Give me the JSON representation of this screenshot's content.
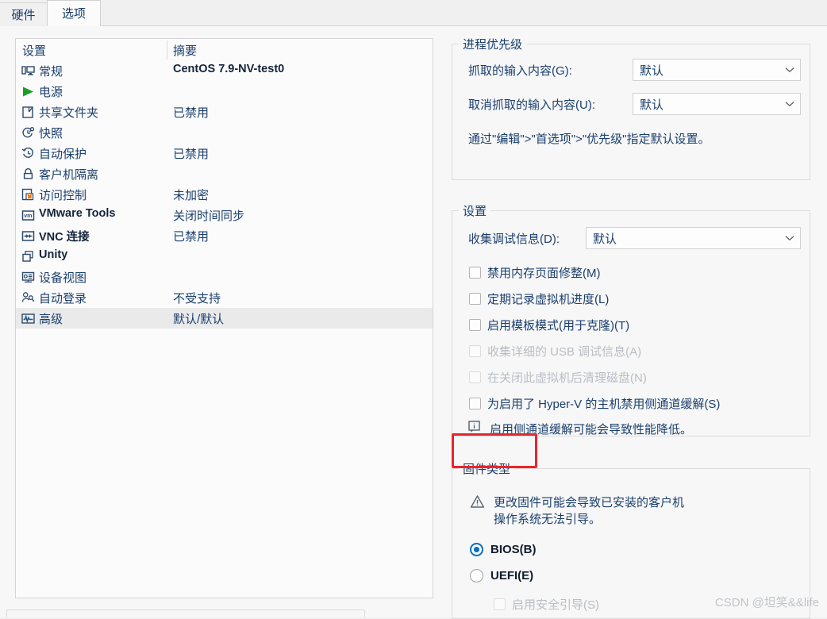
{
  "tabs": [
    {
      "label": "硬件",
      "name": "tab-hardware",
      "active": false
    },
    {
      "label": "选项",
      "name": "tab-options",
      "active": true
    }
  ],
  "list": {
    "headers": {
      "settings": "设置",
      "summary": "摘要"
    },
    "rows": [
      {
        "icon": "monitor-icon",
        "label": "常规",
        "summary": "CentOS 7.9-NV-test0",
        "latin_label": false,
        "latin_summary": true,
        "selected": false
      },
      {
        "icon": "power-play-icon",
        "label": "电源",
        "summary": "",
        "latin_label": false,
        "latin_summary": false,
        "selected": false
      },
      {
        "icon": "shared-folder-icon",
        "label": "共享文件夹",
        "summary": "已禁用",
        "latin_label": false,
        "latin_summary": false,
        "selected": false
      },
      {
        "icon": "snapshot-icon",
        "label": "快照",
        "summary": "",
        "latin_label": false,
        "latin_summary": false,
        "selected": false
      },
      {
        "icon": "autoprotect-icon",
        "label": "自动保护",
        "summary": "已禁用",
        "latin_label": false,
        "latin_summary": false,
        "selected": false
      },
      {
        "icon": "lock-icon",
        "label": "客户机隔离",
        "summary": "",
        "latin_label": false,
        "latin_summary": false,
        "selected": false
      },
      {
        "icon": "access-control-icon",
        "label": "访问控制",
        "summary": "未加密",
        "latin_label": false,
        "latin_summary": false,
        "selected": false
      },
      {
        "icon": "vmware-tools-icon",
        "label": "VMware Tools",
        "summary": "关闭时间同步",
        "latin_label": true,
        "latin_summary": false,
        "selected": false
      },
      {
        "icon": "vnc-icon",
        "label": "VNC 连接",
        "summary": "已禁用",
        "latin_label": true,
        "latin_summary": false,
        "selected": false
      },
      {
        "icon": "unity-icon",
        "label": "Unity",
        "summary": "",
        "latin_label": true,
        "latin_summary": false,
        "selected": false
      },
      {
        "icon": "device-view-icon",
        "label": "设备视图",
        "summary": "",
        "latin_label": false,
        "latin_summary": false,
        "selected": false
      },
      {
        "icon": "autologon-icon",
        "label": "自动登录",
        "summary": "不受支持",
        "latin_label": false,
        "latin_summary": false,
        "selected": false
      },
      {
        "icon": "advanced-icon",
        "label": "高级",
        "summary": "默认/默认",
        "latin_label": false,
        "latin_summary": false,
        "selected": true
      }
    ]
  },
  "options": {
    "priority_group": {
      "title": "进程优先级",
      "grab_label": "抓取的输入内容(G):",
      "grab_value": "默认",
      "ungrab_label": "取消抓取的输入内容(U):",
      "ungrab_value": "默认",
      "hint": "通过\"编辑\">\"首选项\">\"优先级\"指定默认设置。"
    },
    "settings_group": {
      "title": "设置",
      "debug_label": "收集调试信息(D):",
      "debug_value": "默认",
      "checkboxes": [
        {
          "label": "禁用内存页面修整(M)",
          "checked": false,
          "disabled": false
        },
        {
          "label": "定期记录虚拟机进度(L)",
          "checked": false,
          "disabled": false
        },
        {
          "label": "启用模板模式(用于克隆)(T)",
          "checked": false,
          "disabled": false
        },
        {
          "label": "收集详细的 USB 调试信息(A)",
          "checked": false,
          "disabled": true
        },
        {
          "label": "在关闭此虚拟机后清理磁盘(N)",
          "checked": false,
          "disabled": true
        },
        {
          "label": "为启用了 Hyper-V 的主机禁用侧通道缓解(S)",
          "checked": false,
          "disabled": false
        }
      ],
      "info_text": "启用侧通道缓解可能会导致性能降低。"
    },
    "firmware_group": {
      "title": "固件类型",
      "warning": "更改固件可能会导致已安装的客户机\n操作系统无法引导。",
      "radios": [
        {
          "label": "BIOS(B)",
          "checked": true
        },
        {
          "label": "UEFI(E)",
          "checked": false
        }
      ],
      "secure_boot": {
        "label": "启用安全引导(S)",
        "checked": false,
        "disabled": true
      }
    }
  },
  "annotation": {
    "highlight_color": "#e8262b",
    "target": "固件类型"
  },
  "watermark": "CSDN @坦笑&&life"
}
